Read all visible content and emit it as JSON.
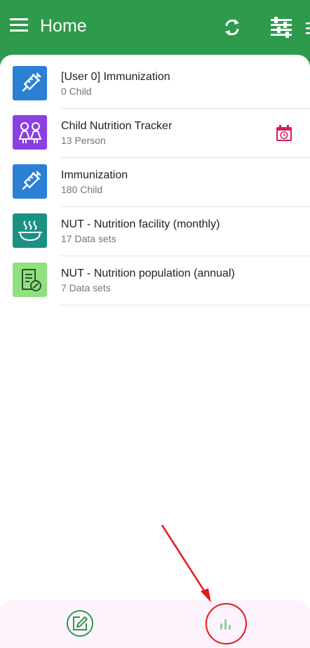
{
  "header": {
    "title": "Home",
    "icons": [
      "menu-icon",
      "sync-icon",
      "filter-icon"
    ]
  },
  "programs": [
    {
      "name": "[User 0] Immunization",
      "count": "0 Child",
      "icon": "syringe-icon",
      "color": "#2b7fd4"
    },
    {
      "name": "Child Nutrition Tracker",
      "count": "13 Person",
      "icon": "children-icon",
      "color": "#8a3fe3",
      "badge": "calendar-clock-icon"
    },
    {
      "name": "Immunization",
      "count": "180 Child",
      "icon": "syringe-icon",
      "color": "#2b7fd4"
    },
    {
      "name": "NUT - Nutrition facility (monthly)",
      "count": "17 Data sets",
      "icon": "hot-dish-icon",
      "color": "#1b9184"
    },
    {
      "name": "NUT - Nutrition population (annual)",
      "count": "7 Data sets",
      "icon": "form-check-icon",
      "color": "#8fe07e"
    }
  ],
  "bottom_nav": {
    "items": [
      "edit-icon",
      "analytics-icon"
    ],
    "accent": "#2e9a4b"
  },
  "colors": {
    "primary": "#2e9a4b",
    "calendar_badge": "#d81b60",
    "annotation": "#e0191b"
  }
}
